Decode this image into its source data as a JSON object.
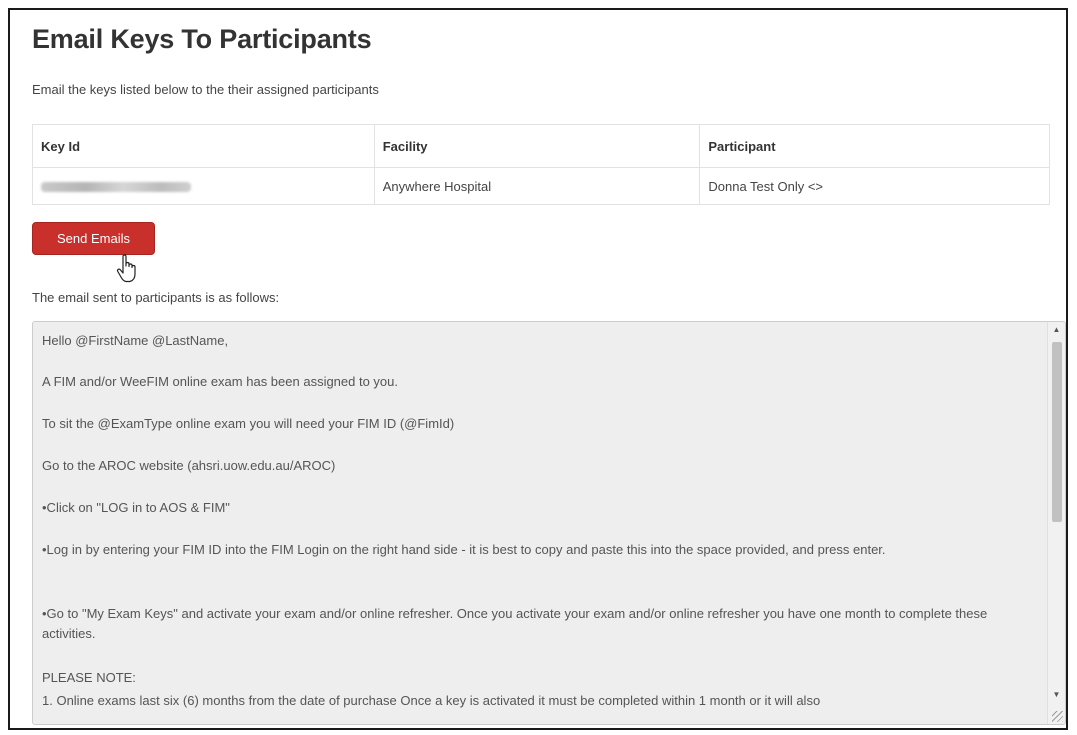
{
  "page": {
    "title": "Email Keys To Participants",
    "intro": "Email the keys listed below to the their assigned participants"
  },
  "keys_table": {
    "headers": [
      "Key Id",
      "Facility",
      "Participant"
    ],
    "rows": [
      {
        "key_id": "",
        "facility": "Anywhere Hospital",
        "participant": "Donna Test Only <>"
      }
    ]
  },
  "actions": {
    "send_label": "Send Emails"
  },
  "email": {
    "label": "The email sent to participants is as follows:",
    "lines": [
      "Hello @FirstName @LastName,",
      "A FIM and/or WeeFIM online exam has been assigned to you.",
      "To sit the @ExamType online exam you will need your FIM ID (@FimId)",
      "Go to the AROC website (ahsri.uow.edu.au/AROC)",
      "•Click on \"LOG in to AOS & FIM\"",
      "•Log in by entering your FIM ID into the FIM Login on the right hand side - it is best to copy and paste this into the space provided, and press enter.",
      "•Go to \"My Exam Keys\" and activate your exam and/or online refresher.  Once you activate your exam and/or online refresher you have one month to complete these activities.",
      "PLEASE NOTE:",
      "1.  Online exams last six (6) months from the date of purchase Once a key is activated it must be completed within 1 month or it will also"
    ]
  },
  "colors": {
    "send_button": "#c9302c",
    "email_box_bg": "#eeeeee"
  }
}
